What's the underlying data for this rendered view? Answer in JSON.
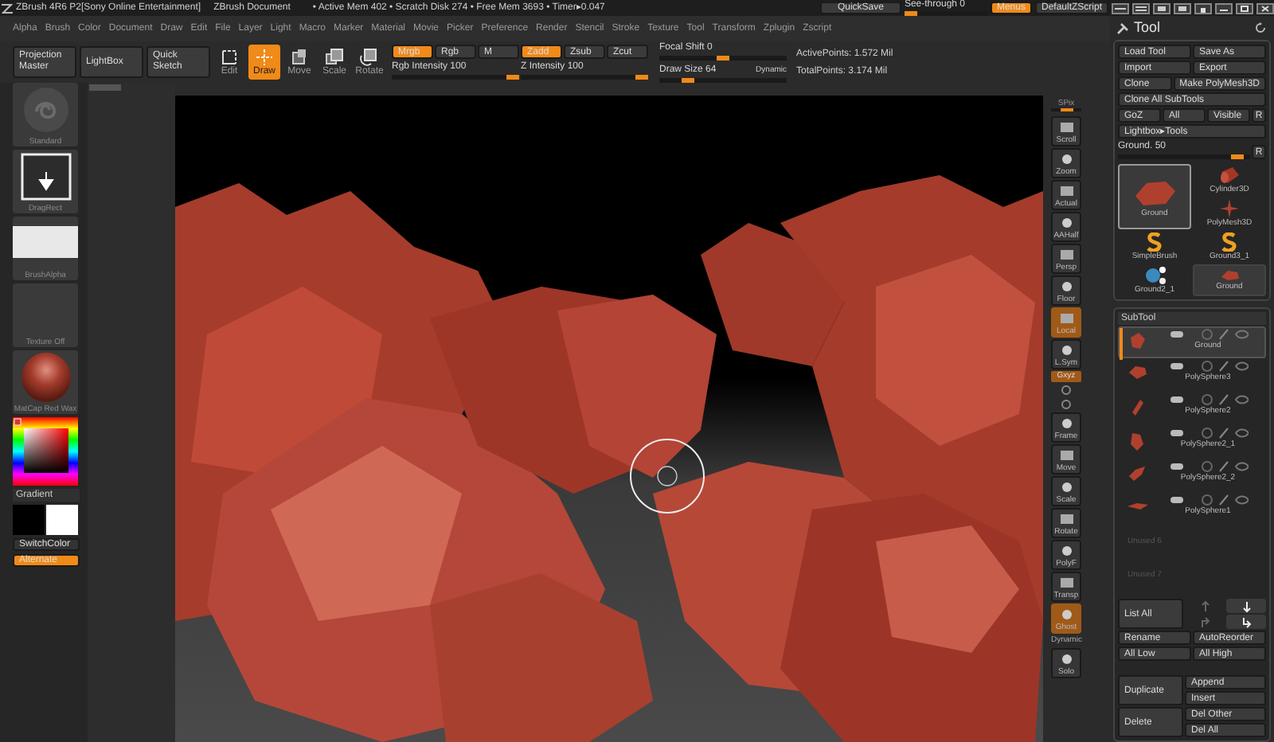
{
  "title_bar": {
    "app": "ZBrush 4R6 P2[Sony Online Entertainment]",
    "document": "ZBrush Document",
    "stats": "• Active Mem 402 • Scratch Disk 274 • Free Mem 3693 • Timer▸0.047",
    "quicksave": "QuickSave",
    "see_through": {
      "label": "See-through  0",
      "level": 0
    },
    "menus": {
      "label": "Menus",
      "on": true
    },
    "script": "DefaultZScript"
  },
  "menu_bar": [
    "Alpha",
    "Brush",
    "Color",
    "Document",
    "Draw",
    "Edit",
    "File",
    "Layer",
    "Light",
    "Macro",
    "Marker",
    "Material",
    "Movie",
    "Picker",
    "Preference",
    "Render",
    "Stencil",
    "Stroke",
    "Texture",
    "Tool",
    "Transform",
    "Zplugin",
    "Zscript"
  ],
  "toolbar": {
    "panels": [
      "Projection Master",
      "LightBox",
      "Quick Sketch"
    ],
    "modes": [
      {
        "label": "Edit",
        "selected": false
      },
      {
        "label": "Draw",
        "selected": true
      },
      {
        "label": "Move",
        "selected": false
      },
      {
        "label": "Scale",
        "selected": false
      },
      {
        "label": "Rotate",
        "selected": false
      }
    ],
    "toggles": [
      {
        "label": "Mrgb",
        "on": true
      },
      {
        "label": "Rgb",
        "on": false
      },
      {
        "label": "M",
        "on": false
      },
      {
        "label": "Zadd",
        "on": true
      },
      {
        "label": "Zsub",
        "on": false
      },
      {
        "label": "Zcut",
        "on": false
      }
    ],
    "sliders": [
      {
        "label": "Rgb Intensity 100",
        "level": 1
      },
      {
        "label": "Z Intensity 100",
        "level": 1
      }
    ],
    "focal_shift": {
      "label": "Focal Shift 0",
      "level": 0.5
    },
    "draw_size": {
      "label": "Draw Size 64",
      "level": 0.2
    },
    "dynamic": "Dynamic",
    "active_points": "ActivePoints: 1.572 Mil",
    "total_points": "TotalPoints: 3.174 Mil"
  },
  "left_shelf": {
    "thumbs": [
      {
        "kind": "brush",
        "label": "Standard"
      },
      {
        "kind": "stroke",
        "label": "DragRect"
      },
      {
        "kind": "alpha",
        "label": "BrushAlpha"
      },
      {
        "kind": "texture",
        "label": "Texture Off"
      },
      {
        "kind": "material",
        "label": "MatCap Red Wax"
      }
    ],
    "gradient": "Gradient",
    "switch_color": "SwitchColor",
    "alternate": {
      "label": "Alternate",
      "on": true
    }
  },
  "right_shelf": [
    {
      "kind": "slider",
      "label": "SPix",
      "level": 0.5
    },
    {
      "kind": "button",
      "label": "Scroll",
      "active": false
    },
    {
      "kind": "button",
      "label": "Zoom",
      "active": false
    },
    {
      "kind": "button",
      "label": "Actual",
      "active": false
    },
    {
      "kind": "button",
      "label": "AAHalf",
      "active": false
    },
    {
      "kind": "button",
      "label": "Persp",
      "active": false
    },
    {
      "kind": "button",
      "label": "Floor",
      "active": false
    },
    {
      "kind": "button",
      "label": "Local",
      "active": true
    },
    {
      "kind": "button",
      "label": "L.Sym",
      "active": false
    },
    {
      "kind": "small",
      "label": "Gxyz",
      "active": true
    },
    {
      "kind": "mini"
    },
    {
      "kind": "mini"
    },
    {
      "kind": "button",
      "label": "Frame",
      "active": false
    },
    {
      "kind": "button",
      "label": "Move",
      "active": false
    },
    {
      "kind": "button",
      "label": "Scale",
      "active": false
    },
    {
      "kind": "button",
      "label": "Rotate",
      "active": false
    },
    {
      "kind": "button",
      "label": "PolyF",
      "active": false
    },
    {
      "kind": "button",
      "label": "Transp",
      "active": false
    },
    {
      "kind": "button",
      "label": "Ghost",
      "active": true
    },
    {
      "kind": "small",
      "label": "Dynamic",
      "active": false
    },
    {
      "kind": "button",
      "label": "Solo",
      "active": false
    }
  ],
  "tool_panel": {
    "title": "Tool",
    "rows": [
      [
        "Load Tool",
        "Save As"
      ],
      [
        "Import",
        "Export"
      ],
      [
        "Clone",
        "Make PolyMesh3D"
      ],
      [
        "Clone All SubTools"
      ],
      [
        "GoZ",
        "All",
        "Visible",
        "R"
      ],
      [
        "Lightbox▸Tools"
      ]
    ],
    "ground_slider": {
      "label": "Ground. 50",
      "level": 0.95,
      "r": "R"
    },
    "tools": [
      {
        "kind": "large",
        "label": "Ground",
        "selected": true
      },
      {
        "kind": "s",
        "label": "SimpleBrush",
        "selected": false
      },
      {
        "kind": "spheres",
        "label": "Ground2_1",
        "selected": false
      },
      {
        "kind": "cylinder",
        "label": "Cylinder3D",
        "selected": false
      },
      {
        "kind": "star",
        "label": "PolyMesh3D",
        "selected": false
      },
      {
        "kind": "s",
        "label": "Ground3_1",
        "selected": false
      },
      {
        "kind": "small",
        "label": "Ground",
        "selected": false
      }
    ]
  },
  "subtool": {
    "title": "SubTool",
    "items": [
      {
        "label": "Ground",
        "selected": true
      },
      {
        "label": "PolySphere3",
        "selected": false
      },
      {
        "label": "PolySphere2",
        "selected": false
      },
      {
        "label": "PolySphere2_1",
        "selected": false
      },
      {
        "label": "PolySphere2_2",
        "selected": false
      },
      {
        "label": "PolySphere1",
        "selected": false
      }
    ],
    "unused": [
      "Unused 6",
      "Unused 7"
    ],
    "list_all": "List All",
    "rows": [
      [
        "Rename",
        "AutoReorder"
      ],
      [
        "All Low",
        "All High"
      ]
    ],
    "duplicate": "Duplicate",
    "duplicate_side": [
      "Append",
      "Insert"
    ],
    "delete": "Delete",
    "delete_side": [
      "Del Other",
      "Del All"
    ]
  }
}
